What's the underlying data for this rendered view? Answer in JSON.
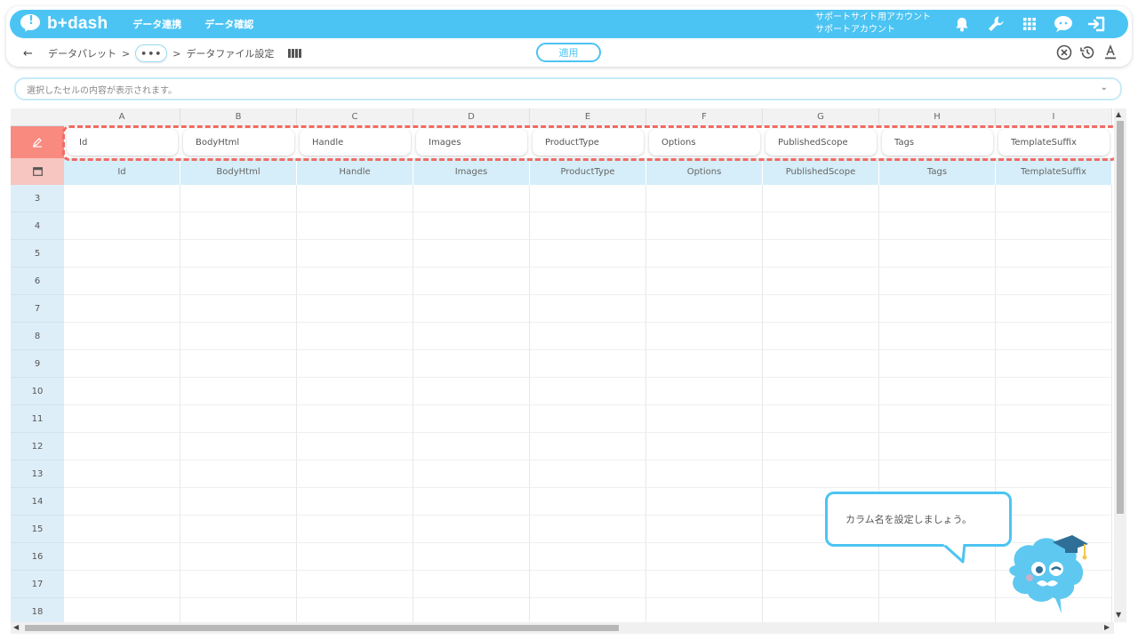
{
  "app": {
    "logo_text": "b+dash",
    "nav": [
      "データ連携",
      "データ確認"
    ],
    "account_line1": "サポートサイト用アカウント",
    "account_line2": "サポートアカウント",
    "top_icons": [
      "bell-icon",
      "wrench-icon",
      "grid-icon",
      "chat-icon",
      "logout-icon"
    ]
  },
  "breadcrumb": {
    "back": "←",
    "first": "データパレット",
    "sep": ">",
    "more": "•••",
    "current": "データファイル設定"
  },
  "toolbar": {
    "apply_label": "適用",
    "right_icons": [
      "close-circle-icon",
      "history-icon",
      "font-color-icon"
    ]
  },
  "formula_bar": {
    "placeholder": "選択したセルの内容が表示されます。",
    "chevron": "⌄"
  },
  "grid": {
    "columns": [
      "A",
      "B",
      "C",
      "D",
      "E",
      "F",
      "G",
      "H",
      "I"
    ],
    "column_names": [
      "Id",
      "BodyHtml",
      "Handle",
      "Images",
      "ProductType",
      "Options",
      "PublishedScope",
      "Tags",
      "TemplateSuffix"
    ],
    "source_names": [
      "Id",
      "BodyHtml",
      "Handle",
      "Images",
      "ProductType",
      "Options",
      "PublishedScope",
      "Tags",
      "TemplateSuffix"
    ],
    "row_numbers": [
      "3",
      "4",
      "5",
      "6",
      "7",
      "8",
      "9",
      "10",
      "11",
      "12",
      "13",
      "14",
      "15",
      "16",
      "17",
      "18"
    ]
  },
  "tooltip": {
    "text": "カラム名を設定しましょう。"
  },
  "colors": {
    "brand": "#4cc4f3",
    "name_row": "#f88a7f",
    "source_row": "#d6eef9",
    "dash": "#f06b63"
  }
}
